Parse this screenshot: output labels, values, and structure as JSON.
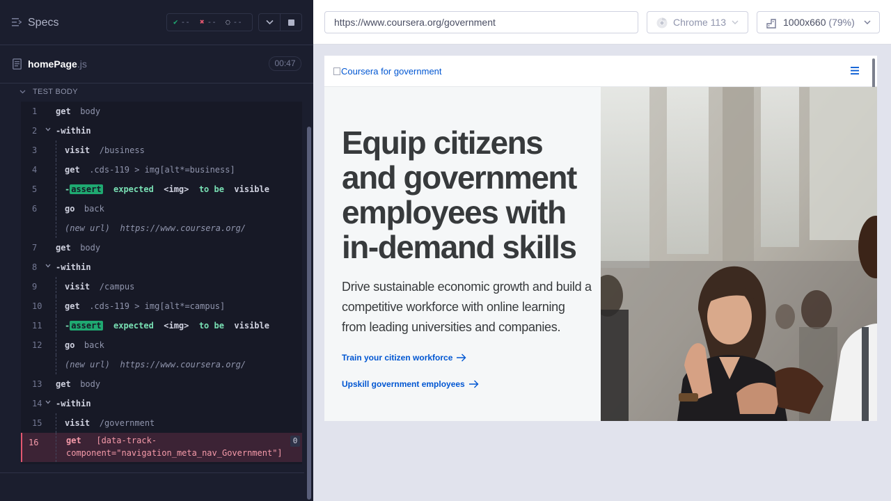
{
  "runner": {
    "title": "Specs",
    "stats": {
      "passed": "--",
      "failed": "--",
      "pending": "--"
    },
    "file": {
      "name": "homePage",
      "ext": ".js",
      "duration": "00:47"
    },
    "section": "TEST BODY"
  },
  "commands": [
    {
      "num": "1",
      "name": "get",
      "msg": "body",
      "indent": 0
    },
    {
      "num": "2",
      "name": "-within",
      "msg": "",
      "indent": 0,
      "toggle": true
    },
    {
      "num": "3",
      "name": "visit",
      "msg": "/business",
      "indent": 1
    },
    {
      "num": "4",
      "name": "get",
      "msg": ".cds-119 > img[alt*=business]",
      "indent": 1
    },
    {
      "num": "5",
      "assert": true,
      "badge": "assert",
      "expect": "expected",
      "subject": "<img>",
      "tobe": "to be",
      "state": "visible",
      "indent": 1
    },
    {
      "num": "6",
      "name": "go",
      "msg": "back",
      "indent": 1
    },
    {
      "num": "",
      "url": true,
      "label": "(new url)",
      "msg": "https://www.coursera.org/",
      "indent": 1
    },
    {
      "num": "7",
      "name": "get",
      "msg": "body",
      "indent": 0
    },
    {
      "num": "8",
      "name": "-within",
      "msg": "",
      "indent": 0,
      "toggle": true
    },
    {
      "num": "9",
      "name": "visit",
      "msg": "/campus",
      "indent": 1
    },
    {
      "num": "10",
      "name": "get",
      "msg": ".cds-119 > img[alt*=campus]",
      "indent": 1
    },
    {
      "num": "11",
      "assert": true,
      "badge": "assert",
      "expect": "expected",
      "subject": "<img>",
      "tobe": "to be",
      "state": "visible",
      "indent": 1
    },
    {
      "num": "12",
      "name": "go",
      "msg": "back",
      "indent": 1
    },
    {
      "num": "",
      "url": true,
      "label": "(new url)",
      "msg": "https://www.coursera.org/",
      "indent": 1
    },
    {
      "num": "13",
      "name": "get",
      "msg": "body",
      "indent": 0
    },
    {
      "num": "14",
      "name": "-within",
      "msg": "",
      "indent": 0,
      "toggle": true
    },
    {
      "num": "15",
      "name": "visit",
      "msg": "/government",
      "indent": 1
    },
    {
      "num": "16",
      "name": "get",
      "msg": "[data-track-\ncomponent=\"navigation_meta_nav_Government\"]",
      "indent": 1,
      "active": true,
      "count": "0"
    }
  ],
  "aut": {
    "url": "https://www.coursera.org/government",
    "browser": "Chrome 113",
    "viewport": "1000x660",
    "zoom": "(79%)"
  },
  "site": {
    "logo_alt": "Coursera for government",
    "hero_title": "Equip citizens and government employees with in-demand skills",
    "hero_sub": "Drive sustainable economic growth and build a competitive workforce with online learning from leading universities and companies.",
    "link1": "Train your citizen workforce",
    "link2": "Upskill government employees"
  },
  "colors": {
    "runner_bg": "#1b1e2e",
    "assert_green": "#1fa971",
    "failed_red": "#e45770",
    "link_blue": "#0056d2"
  }
}
